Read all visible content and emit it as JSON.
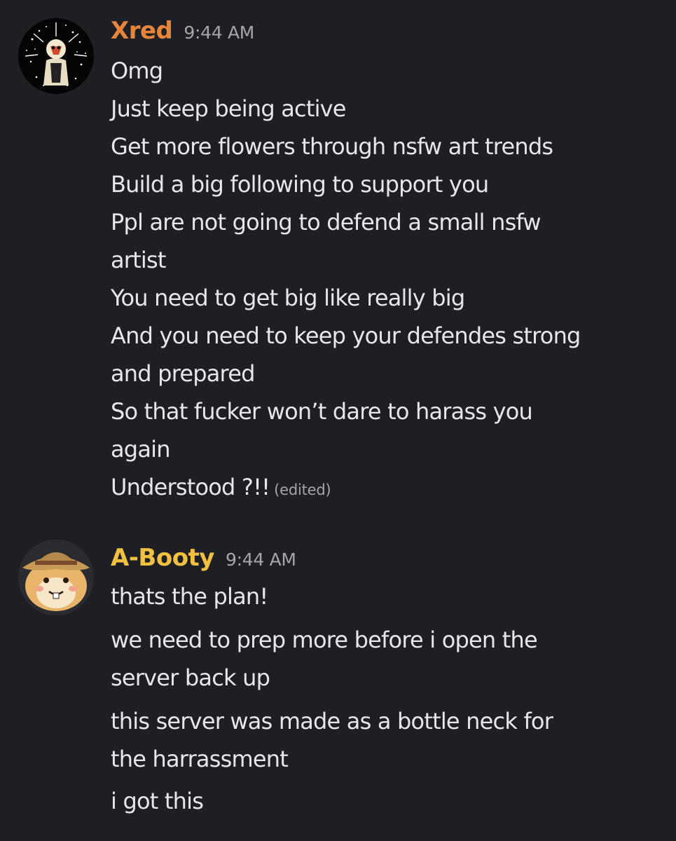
{
  "messages": [
    {
      "author": "Xred",
      "author_color": "#e8853b",
      "timestamp": "9:44 AM",
      "avatar_icon": "starry-skull-avatar-icon",
      "lines": [
        "Omg",
        "Just keep being active",
        "Get more flowers through nsfw art trends",
        "Build a big following to support you",
        "Ppl are not going to defend a small nsfw",
        "artist",
        "You need to get big like really big",
        "And you need to keep your defendes strong",
        "and prepared",
        "So that fucker won’t dare to harass you",
        "again",
        "Understood ?!!"
      ],
      "edited_label": "(edited)"
    },
    {
      "author": "A-Booty",
      "author_color": "#f0c040",
      "timestamp": "9:44 AM",
      "avatar_icon": "hamster-explorer-avatar-icon",
      "lines": [
        "thats the plan!",
        "we need to prep more before i open the",
        "server back up",
        "this server was made as a bottle neck for",
        "the harrassment",
        "i got this"
      ]
    }
  ]
}
